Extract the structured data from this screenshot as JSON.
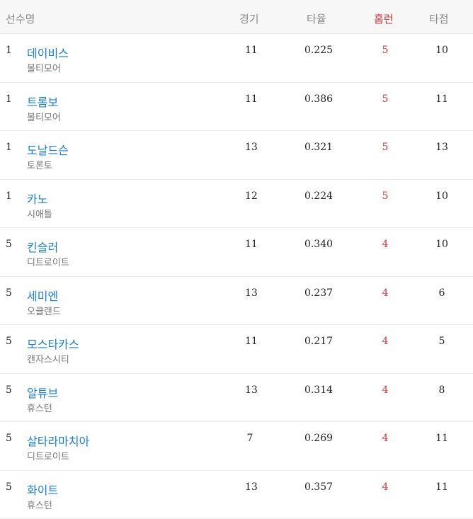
{
  "header": {
    "player": "선수명",
    "games": "경기",
    "avg": "타율",
    "hr": "홈런",
    "rbi": "타점"
  },
  "rows": [
    {
      "rank": "1",
      "name": "데이비스",
      "team": "볼티모어",
      "games": "11",
      "avg": "0.225",
      "hr": "5",
      "rbi": "10"
    },
    {
      "rank": "1",
      "name": "트롬보",
      "team": "볼티모어",
      "games": "11",
      "avg": "0.386",
      "hr": "5",
      "rbi": "11"
    },
    {
      "rank": "1",
      "name": "도날드슨",
      "team": "토론토",
      "games": "13",
      "avg": "0.321",
      "hr": "5",
      "rbi": "13"
    },
    {
      "rank": "1",
      "name": "카노",
      "team": "시애틀",
      "games": "12",
      "avg": "0.224",
      "hr": "5",
      "rbi": "10"
    },
    {
      "rank": "5",
      "name": "킨슬러",
      "team": "디트로이트",
      "games": "11",
      "avg": "0.340",
      "hr": "4",
      "rbi": "10"
    },
    {
      "rank": "5",
      "name": "세미엔",
      "team": "오클랜드",
      "games": "13",
      "avg": "0.237",
      "hr": "4",
      "rbi": "6"
    },
    {
      "rank": "5",
      "name": "모스타카스",
      "team": "캔자스시티",
      "games": "11",
      "avg": "0.217",
      "hr": "4",
      "rbi": "5"
    },
    {
      "rank": "5",
      "name": "알튜브",
      "team": "휴스턴",
      "games": "13",
      "avg": "0.314",
      "hr": "4",
      "rbi": "8"
    },
    {
      "rank": "5",
      "name": "살타라마치아",
      "team": "디트로이트",
      "games": "7",
      "avg": "0.269",
      "hr": "4",
      "rbi": "11"
    },
    {
      "rank": "5",
      "name": "화이트",
      "team": "휴스턴",
      "games": "13",
      "avg": "0.357",
      "hr": "4",
      "rbi": "11"
    }
  ]
}
